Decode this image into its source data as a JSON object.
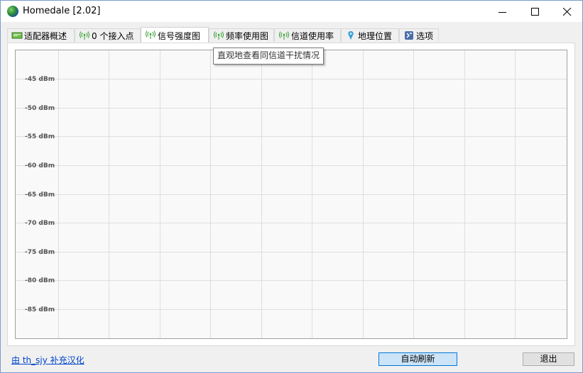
{
  "window": {
    "title": "Homedale [2.02]"
  },
  "tabs": [
    {
      "label": "适配器概述",
      "icon": "adapter-icon"
    },
    {
      "label": "0 个接入点",
      "icon": "wifi-signal-icon"
    },
    {
      "label": "信号强度图",
      "icon": "wifi-signal-icon",
      "active": true
    },
    {
      "label": "频率使用图",
      "icon": "wifi-signal-icon"
    },
    {
      "label": "信道使用率",
      "icon": "wifi-signal-icon"
    },
    {
      "label": "地理位置",
      "icon": "location-pin-icon"
    },
    {
      "label": "选项",
      "icon": "options-icon"
    }
  ],
  "tooltip": {
    "text": "直观地查看同信道干扰情况"
  },
  "chart_data": {
    "type": "line",
    "title": "",
    "xlabel": "",
    "ylabel": "",
    "y_ticks": [
      "-45 dBm",
      "-50 dBm",
      "-55 dBm",
      "-60 dBm",
      "-65 dBm",
      "-70 dBm",
      "-75 dBm",
      "-80 dBm",
      "-85 dBm"
    ],
    "ylim": [
      -90,
      -40
    ],
    "grid": true,
    "series": []
  },
  "footer": {
    "credit_link": "由 th_sjy 补充汉化",
    "refresh_button": "自动刷新",
    "exit_button": "退出"
  },
  "colors": {
    "accent": "#0078d7",
    "link": "#0044cc",
    "tab_icon_green": "#2e9e2e"
  }
}
